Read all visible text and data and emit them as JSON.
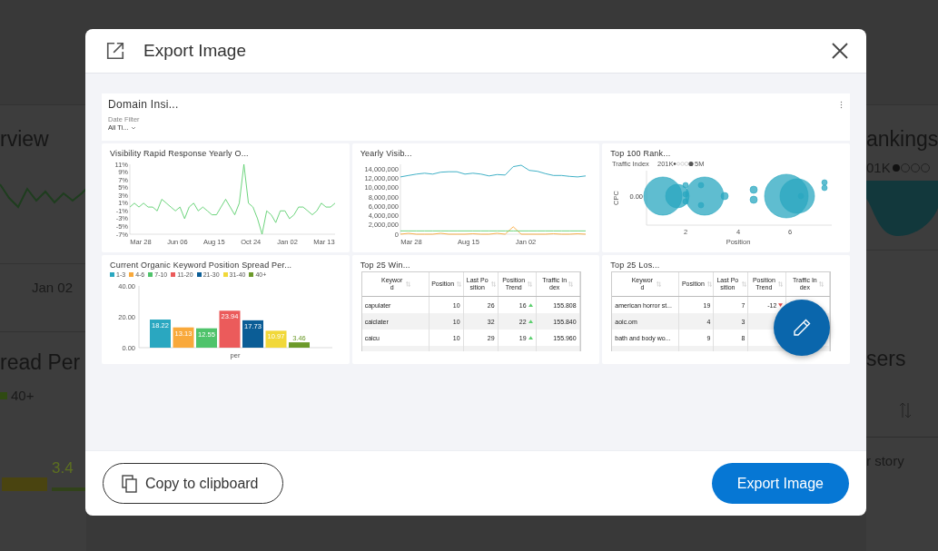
{
  "background": {
    "left": {
      "title": "rview",
      "axis_label": "Jan 02",
      "section_title": "read Per",
      "legend_label": "40+",
      "bar_label": "3.4"
    },
    "right": {
      "title": "ankings",
      "legend_label": "01K",
      "section_title": "sers",
      "cell": "r story"
    }
  },
  "dialog": {
    "title": "Export Image",
    "preview": {
      "title": "Domain Insi...",
      "date_filter_label": "Date Filter",
      "date_filter_value": "All Ti...",
      "widgets": [
        {
          "kind": "chart",
          "title": "Visibility Rapid Response Yearly O...",
          "x_labels": [
            "Mar 28",
            "Jun 06",
            "Aug 15",
            "Oct 24",
            "Jan 02",
            "Mar 13"
          ],
          "chart_data": {
            "type": "line",
            "ylim": [
              -7,
              11
            ],
            "yticks": [
              {
                "value": 11,
                "label": "11%"
              },
              {
                "value": 9,
                "label": "9%"
              },
              {
                "value": 7,
                "label": "7%"
              },
              {
                "value": 5,
                "label": "5%"
              },
              {
                "value": 3,
                "label": "3%"
              },
              {
                "value": 1,
                "label": "1%"
              },
              {
                "value": -1,
                "label": "-1%"
              },
              {
                "value": -3,
                "label": "-3%"
              },
              {
                "value": -5,
                "label": "-5%"
              },
              {
                "value": -7,
                "label": "-7%"
              }
            ],
            "series": [
              {
                "color": "#5ccf6e",
                "values": [
                  0,
                  1,
                  0,
                  1,
                  0,
                  0,
                  -1,
                  2,
                  1,
                  0,
                  -1,
                  0,
                  -3,
                  0,
                  1,
                  -1,
                  0,
                  -1,
                  -2,
                  -2,
                  0,
                  2,
                  0,
                  -2,
                  1,
                  11,
                  1,
                  0,
                  -3,
                  -7,
                  -1,
                  -2,
                  -4,
                  -1,
                  -1,
                  -3,
                  -2,
                  0,
                  0,
                  -1,
                  -2,
                  -1,
                  1,
                  0,
                  0,
                  1
                ]
              }
            ]
          }
        },
        {
          "kind": "chart",
          "title": "Yearly Visib...",
          "x_labels": [
            "Mar 28",
            "Aug 15",
            "Jan 02"
          ],
          "chart_data": {
            "type": "line",
            "ylim": [
              0,
              15000000
            ],
            "yticks": [
              {
                "value": 14000000,
                "label": "14,000,000"
              },
              {
                "value": 12000000,
                "label": "12,000,000"
              },
              {
                "value": 10000000,
                "label": "10,000,000"
              },
              {
                "value": 8000000,
                "label": "8,000,000"
              },
              {
                "value": 6000000,
                "label": "6,000,000"
              },
              {
                "value": 4000000,
                "label": "4,000,000"
              },
              {
                "value": 2000000,
                "label": "2,000,000"
              },
              {
                "value": 0,
                "label": "0"
              }
            ],
            "series": [
              {
                "color": "#2aa7c0",
                "values": [
                  12300000,
                  12600000,
                  12900000,
                  13100000,
                  12900000,
                  13300000,
                  13400000,
                  13400000,
                  12900000,
                  13100000,
                  12900000,
                  12500000,
                  12800000,
                  12700000,
                  14500000,
                  14800000,
                  13700000,
                  13500000,
                  13000000,
                  12600000,
                  12600000,
                  12400000,
                  12300000,
                  12500000
                ]
              },
              {
                "color": "#f9a93b",
                "values": [
                  0,
                  200000,
                  0,
                  0,
                  0,
                  200000,
                  0,
                  0,
                  0,
                  100000,
                  0,
                  0,
                  200000,
                  0,
                  1600000,
                  0,
                  0,
                  0,
                  0,
                  100000,
                  0,
                  0,
                  100000,
                  0
                ]
              },
              {
                "color": "#5ccf6e",
                "values": [
                  700000,
                  700000,
                  700000,
                  700000,
                  700000,
                  700000,
                  700000,
                  700000,
                  700000,
                  700000,
                  700000,
                  700000,
                  700000,
                  700000,
                  700000,
                  700000,
                  700000,
                  700000,
                  700000,
                  700000,
                  700000,
                  700000,
                  700000,
                  700000
                ]
              }
            ]
          }
        },
        {
          "kind": "bubbles",
          "title": "Top 100 Rank...",
          "size_legend": {
            "title": "Traffic Index",
            "min": "201K",
            "max": "5M"
          },
          "y_axis_title": "CPC",
          "y_label": "0.00",
          "x_labels": [
            "2",
            "4",
            "6"
          ],
          "x_axis_title": "Position"
        },
        {
          "kind": "chart",
          "title": "Current Organic Keyword Position Spread Per...",
          "chart_data": {
            "type": "bar",
            "categories": [
              "per"
            ],
            "ylim": [
              0,
              40
            ],
            "yticks": [
              {
                "value": 0,
                "label": "0.00"
              },
              {
                "value": 20,
                "label": "20.00"
              },
              {
                "value": 40,
                "label": "40.00"
              }
            ],
            "data_labels": true,
            "legend": "top",
            "series": [
              {
                "name": "1-3",
                "color": "#2aa7c0",
                "values": [
                  18.22
                ]
              },
              {
                "name": "4-6",
                "color": "#f9a93b",
                "values": [
                  13.13
                ]
              },
              {
                "name": "7-10",
                "color": "#4fc36b",
                "values": [
                  12.55
                ]
              },
              {
                "name": "11-20",
                "color": "#eb5b5b",
                "values": [
                  23.94
                ]
              },
              {
                "name": "21-30",
                "color": "#0b5d96",
                "values": [
                  17.73
                ]
              },
              {
                "name": "31-40",
                "color": "#f1d83a",
                "values": [
                  10.97
                ]
              },
              {
                "name": "40+",
                "color": "#6c9a2a",
                "values": [
                  3.46
                ]
              }
            ]
          }
        },
        {
          "kind": "table",
          "title": "Top 25 Win...",
          "columns": [
            "Keyword",
            "Position",
            "Last Position",
            "Position Trend",
            "Traffic Index"
          ],
          "rows": [
            {
              "cells": [
                "capulater",
                "10",
                "26",
                "16",
                "155.808"
              ],
              "kind": "up"
            },
            {
              "cells": [
                "caiclater",
                "10",
                "32",
                "22",
                "155.840"
              ],
              "kind": "up"
            },
            {
              "cells": [
                "caicu",
                "10",
                "29",
                "19",
                "155.960"
              ],
              "kind": "up"
            }
          ]
        },
        {
          "kind": "table",
          "title": "Top 25 Los...",
          "columns": [
            "Keyword",
            "Position",
            "Last Position",
            "Position Trend",
            "Traffic Index"
          ],
          "rows": [
            {
              "cells": [
                "american horror st...",
                "19",
                "7",
                "-12",
                null
              ],
              "kind": "down"
            },
            {
              "cells": [
                "aoic.om",
                "4",
                "3",
                null,
                null
              ],
              "kind": "plain"
            },
            {
              "cells": [
                "bath and body wo...",
                "9",
                "8",
                null,
                null
              ],
              "kind": "plain"
            }
          ]
        }
      ]
    },
    "buttons": [
      {
        "label": "Copy to clipboard",
        "kind": "secondary"
      },
      {
        "label": "Export Image",
        "kind": "primary"
      }
    ]
  }
}
